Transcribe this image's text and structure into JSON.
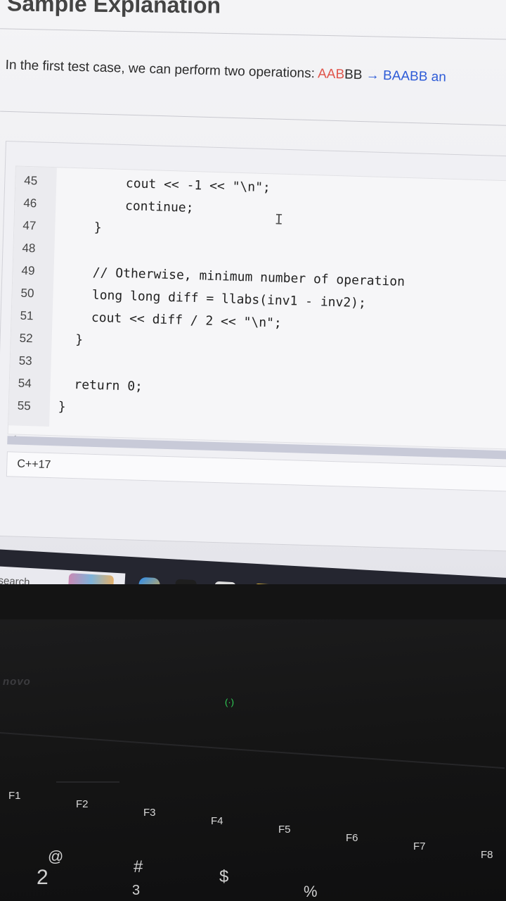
{
  "heading": "Sample Explanation",
  "explanation": {
    "intro": "In the first test case, we can perform two operations: ",
    "red_part": "AAB",
    "black_part": "BB",
    "arrow": " → ",
    "blue_part": "BAABB an"
  },
  "code_lines": [
    {
      "no": "45",
      "text": "        cout << -1 << \"\\n\";"
    },
    {
      "no": "46",
      "text": "        continue;"
    },
    {
      "no": "47",
      "text": "    }"
    },
    {
      "no": "48",
      "text": ""
    },
    {
      "no": "49",
      "text": "    // Otherwise, minimum number of operation"
    },
    {
      "no": "50",
      "text": "    long long diff = llabs(inv1 - inv2);"
    },
    {
      "no": "51",
      "text": "    cout << diff / 2 << \"\\n\";"
    },
    {
      "no": "52",
      "text": "  }"
    },
    {
      "no": "53",
      "text": ""
    },
    {
      "no": "54",
      "text": "  return 0;"
    },
    {
      "no": "55",
      "text": "}"
    }
  ],
  "language": "C++17",
  "taskbar": {
    "search_label": "search",
    "icons": [
      "photos-icon",
      "copilot-icon",
      "terminal-icon",
      "mail-icon",
      "files-icon",
      "edge-icon",
      "store-icon",
      "chrome-icon",
      "intellij-icon",
      "word-icon"
    ]
  },
  "laptop": {
    "brand": "novo",
    "function_keys": [
      "F1",
      "F2",
      "F3",
      "F4",
      "F5",
      "F6",
      "F7",
      "F8"
    ],
    "number_keys": [
      "@",
      "2",
      "#",
      "3",
      "$",
      "%"
    ]
  }
}
